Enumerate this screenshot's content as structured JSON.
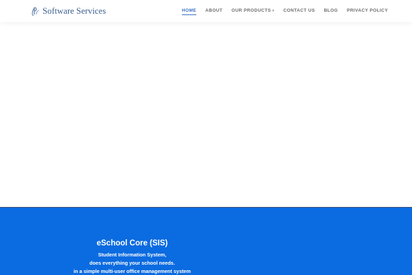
{
  "colors": {
    "brand_text": "#3a5d8f",
    "nav_active": "#3a6fc4",
    "nav_default": "#6b6b6b",
    "hero_background": "#0b6be0"
  },
  "header": {
    "logo_icon": "sp-logo-icon",
    "brand_name": "Software Services"
  },
  "nav": {
    "items": [
      {
        "label": "HOME",
        "active": true
      },
      {
        "label": "ABOUT"
      },
      {
        "label": "OUR PRODUCTS",
        "dropdown_icon": "caret-down-icon"
      },
      {
        "label": "CONTACT US"
      },
      {
        "label": "BLOG"
      },
      {
        "label": "PRIVACY POLICY"
      }
    ]
  },
  "hero": {
    "title": "eSchool Core (SIS)",
    "lines": [
      "Student Information System,",
      "does everything your school needs.",
      "in a simple multi-user office management system"
    ]
  }
}
